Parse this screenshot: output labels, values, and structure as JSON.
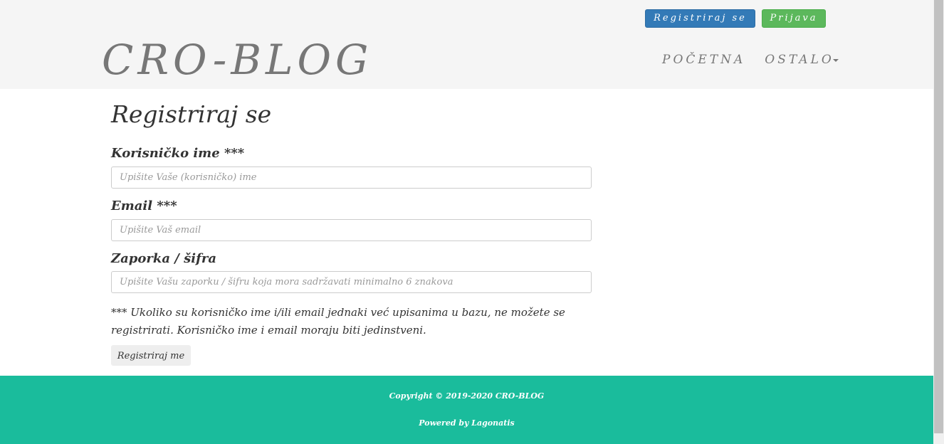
{
  "header": {
    "register_button": "Registriraj se",
    "login_button": "Prijava",
    "logo": "CRO-BLOG",
    "nav": {
      "home": "POČETNA",
      "other": "OSTALO"
    }
  },
  "form": {
    "title": "Registriraj se",
    "username": {
      "label": "Korisničko ime ***",
      "placeholder": "Upišite Vaše (korisničko) ime"
    },
    "email": {
      "label": "Email ***",
      "placeholder": "Upišite Vaš email"
    },
    "password": {
      "label": "Zaporka / šifra",
      "placeholder": "Upišite Vašu zaporku / šifru koja mora sadržavati minimalno 6 znakova"
    },
    "note": "*** Ukoliko su korisničko ime i/ili email jednaki već upisanima u bazu, ne možete se registrirati. Korisničko ime i email moraju biti jedinstveni.",
    "submit_button": "Registriraj me"
  },
  "footer": {
    "copyright": "Copyright © 2019-2020 CRO-BLOG",
    "powered_prefix": "Powered by",
    "powered_link": "Lagonatis"
  },
  "colors": {
    "primary": "#337ab7",
    "success": "#5cb85c",
    "footer": "#1abc9c",
    "header_bg": "#f5f5f5"
  }
}
